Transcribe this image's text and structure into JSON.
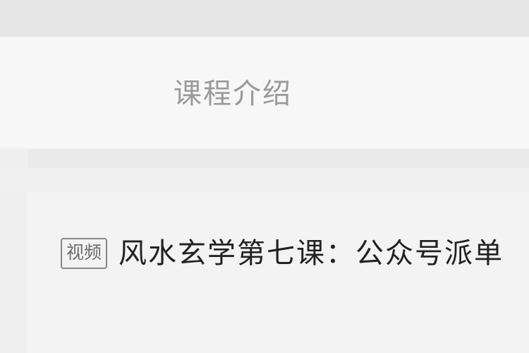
{
  "header": {
    "tab_label": "课程介绍"
  },
  "lesson": {
    "badge": "视频",
    "title": "风水玄学第七课：公众号派单"
  }
}
